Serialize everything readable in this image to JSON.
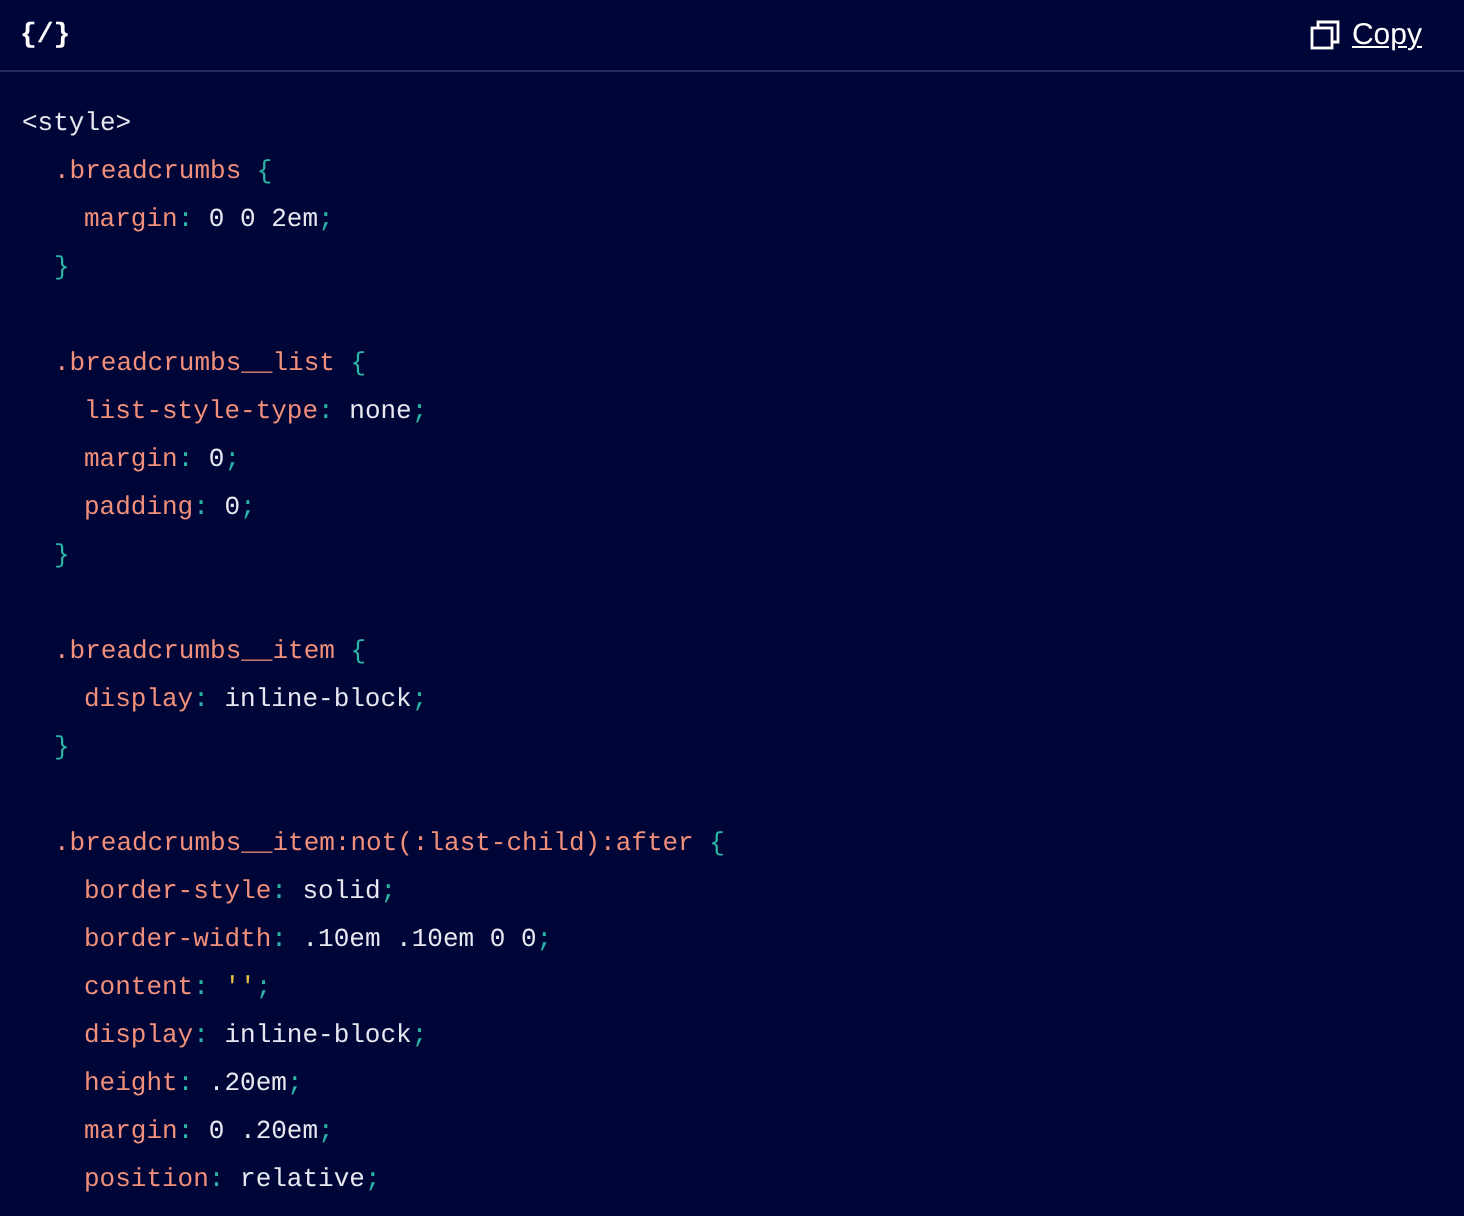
{
  "header": {
    "logo": "{/}",
    "copy_button": "Copy"
  },
  "code": [
    {
      "kind": "tag",
      "tokens": [
        {
          "kind": "tag",
          "text": "<style>"
        }
      ]
    },
    {
      "kind": "rule",
      "tokens": [
        {
          "kind": "selector",
          "text": ".breadcrumbs "
        },
        {
          "kind": "punct",
          "text": "{"
        }
      ]
    },
    {
      "kind": "decl",
      "tokens": [
        {
          "kind": "property",
          "text": "margin"
        },
        {
          "kind": "punct",
          "text": ": "
        },
        {
          "kind": "value",
          "text": "0 0 2em"
        },
        {
          "kind": "punct",
          "text": ";"
        }
      ]
    },
    {
      "kind": "rule",
      "tokens": [
        {
          "kind": "punct",
          "text": "}"
        }
      ]
    },
    {
      "kind": "blank"
    },
    {
      "kind": "rule",
      "tokens": [
        {
          "kind": "selector",
          "text": ".breadcrumbs__list "
        },
        {
          "kind": "punct",
          "text": "{"
        }
      ]
    },
    {
      "kind": "decl",
      "tokens": [
        {
          "kind": "property",
          "text": "list-style-type"
        },
        {
          "kind": "punct",
          "text": ": "
        },
        {
          "kind": "value",
          "text": "none"
        },
        {
          "kind": "punct",
          "text": ";"
        }
      ]
    },
    {
      "kind": "decl",
      "tokens": [
        {
          "kind": "property",
          "text": "margin"
        },
        {
          "kind": "punct",
          "text": ": "
        },
        {
          "kind": "value",
          "text": "0"
        },
        {
          "kind": "punct",
          "text": ";"
        }
      ]
    },
    {
      "kind": "decl",
      "tokens": [
        {
          "kind": "property",
          "text": "padding"
        },
        {
          "kind": "punct",
          "text": ": "
        },
        {
          "kind": "value",
          "text": "0"
        },
        {
          "kind": "punct",
          "text": ";"
        }
      ]
    },
    {
      "kind": "rule",
      "tokens": [
        {
          "kind": "punct",
          "text": "}"
        }
      ]
    },
    {
      "kind": "blank"
    },
    {
      "kind": "rule",
      "tokens": [
        {
          "kind": "selector",
          "text": ".breadcrumbs__item "
        },
        {
          "kind": "punct",
          "text": "{"
        }
      ]
    },
    {
      "kind": "decl",
      "tokens": [
        {
          "kind": "property",
          "text": "display"
        },
        {
          "kind": "punct",
          "text": ": "
        },
        {
          "kind": "value",
          "text": "inline-block"
        },
        {
          "kind": "punct",
          "text": ";"
        }
      ]
    },
    {
      "kind": "rule",
      "tokens": [
        {
          "kind": "punct",
          "text": "}"
        }
      ]
    },
    {
      "kind": "blank"
    },
    {
      "kind": "rule",
      "tokens": [
        {
          "kind": "selector",
          "text": ".breadcrumbs__item:not(:last-child):after "
        },
        {
          "kind": "punct",
          "text": "{"
        }
      ]
    },
    {
      "kind": "decl",
      "tokens": [
        {
          "kind": "property",
          "text": "border-style"
        },
        {
          "kind": "punct",
          "text": ": "
        },
        {
          "kind": "value",
          "text": "solid"
        },
        {
          "kind": "punct",
          "text": ";"
        }
      ]
    },
    {
      "kind": "decl",
      "tokens": [
        {
          "kind": "property",
          "text": "border-width"
        },
        {
          "kind": "punct",
          "text": ": "
        },
        {
          "kind": "value",
          "text": ".10em .10em 0 0"
        },
        {
          "kind": "punct",
          "text": ";"
        }
      ]
    },
    {
      "kind": "decl",
      "tokens": [
        {
          "kind": "property",
          "text": "content"
        },
        {
          "kind": "punct",
          "text": ": "
        },
        {
          "kind": "string",
          "text": "''"
        },
        {
          "kind": "punct",
          "text": ";"
        }
      ]
    },
    {
      "kind": "decl",
      "tokens": [
        {
          "kind": "property",
          "text": "display"
        },
        {
          "kind": "punct",
          "text": ": "
        },
        {
          "kind": "value",
          "text": "inline-block"
        },
        {
          "kind": "punct",
          "text": ";"
        }
      ]
    },
    {
      "kind": "decl",
      "tokens": [
        {
          "kind": "property",
          "text": "height"
        },
        {
          "kind": "punct",
          "text": ": "
        },
        {
          "kind": "value",
          "text": ".20em"
        },
        {
          "kind": "punct",
          "text": ";"
        }
      ]
    },
    {
      "kind": "decl",
      "tokens": [
        {
          "kind": "property",
          "text": "margin"
        },
        {
          "kind": "punct",
          "text": ": "
        },
        {
          "kind": "value",
          "text": "0 .20em"
        },
        {
          "kind": "punct",
          "text": ";"
        }
      ]
    },
    {
      "kind": "decl",
      "tokens": [
        {
          "kind": "property",
          "text": "position"
        },
        {
          "kind": "punct",
          "text": ": "
        },
        {
          "kind": "value",
          "text": "relative"
        },
        {
          "kind": "punct",
          "text": ";"
        }
      ]
    }
  ]
}
